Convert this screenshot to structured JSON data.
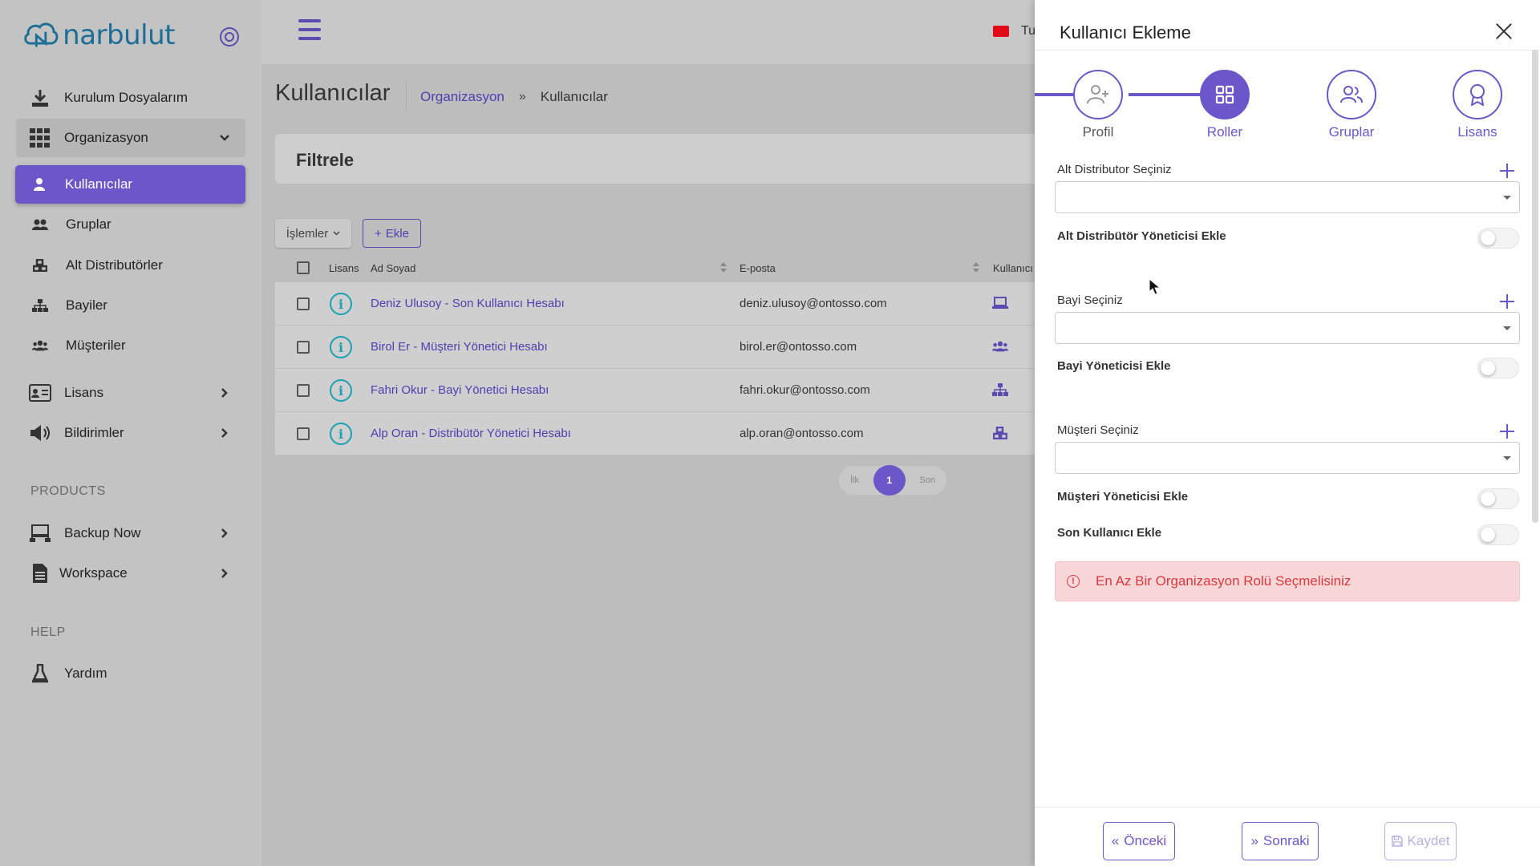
{
  "brand": {
    "name": "narbulut"
  },
  "sidebar": {
    "items": [
      {
        "label": "Kurulum Dosyalarım",
        "icon": "download-icon"
      },
      {
        "label": "Organizasyon",
        "icon": "grid-icon"
      },
      {
        "label": "Kullanıcılar",
        "icon": "user-icon"
      },
      {
        "label": "Gruplar",
        "icon": "users-icon"
      },
      {
        "label": "Alt Distributörler",
        "icon": "cubes-icon"
      },
      {
        "label": "Bayiler",
        "icon": "sitemap-icon"
      },
      {
        "label": "Müşteriler",
        "icon": "users-group-icon"
      },
      {
        "label": "Lisans",
        "icon": "id-card-icon"
      },
      {
        "label": "Bildirimler",
        "icon": "megaphone-icon"
      },
      {
        "label": "Backup Now",
        "icon": "network-icon"
      },
      {
        "label": "Workspace",
        "icon": "file-icon"
      },
      {
        "label": "Yardım",
        "icon": "flask-icon"
      }
    ],
    "sections": {
      "products": "PRODUCTS",
      "help": "HELP"
    }
  },
  "topbar": {
    "lang": "Tu"
  },
  "page": {
    "title": "Kullanıcılar",
    "breadcrumb": {
      "link": "Organizasyon",
      "sep": "»",
      "current": "Kullanıcılar"
    },
    "filter_title": "Filtrele",
    "ops_label": "İşlemler",
    "add_label": "Ekle"
  },
  "table": {
    "headers": {
      "license": "Lisans",
      "name": "Ad Soyad",
      "email": "E-posta",
      "type": "Kullanıcı"
    },
    "rows": [
      {
        "name": "Deniz Ulusoy - Son Kullanıcı Hesabı",
        "email": "deniz.ulusoy@ontosso.com",
        "type_icon": "laptop-icon"
      },
      {
        "name": "Birol Er - Müşteri Yönetici Hesabı",
        "email": "birol.er@ontosso.com",
        "type_icon": "users-group-icon"
      },
      {
        "name": "Fahri Okur - Bayi Yönetici Hesabı",
        "email": "fahri.okur@ontosso.com",
        "type_icon": "sitemap-icon"
      },
      {
        "name": "Alp Oran - Distribütör Yönetici Hesabı",
        "email": "alp.oran@ontosso.com",
        "type_icon": "cubes-icon"
      }
    ]
  },
  "pager": {
    "first": "İlk",
    "current": "1",
    "last": "Son"
  },
  "drawer": {
    "title": "Kullanıcı Ekleme",
    "steps": [
      {
        "label": "Profil",
        "icon": "user-plus-icon",
        "state": "done"
      },
      {
        "label": "Roller",
        "icon": "grid-icon",
        "state": "active"
      },
      {
        "label": "Gruplar",
        "icon": "users-icon",
        "state": "pending"
      },
      {
        "label": "Lisans",
        "icon": "award-icon",
        "state": "pending"
      }
    ],
    "alt_distributor_label": "Alt Distributor Seçiniz",
    "alt_distributor_admin": "Alt Distribütör Yöneticisi Ekle",
    "bayi_label": "Bayi Seçiniz",
    "bayi_admin": "Bayi Yöneticisi Ekle",
    "musteri_label": "Müşteri Seçiniz",
    "musteri_admin": "Müşteri Yöneticisi Ekle",
    "son_kullanici": "Son Kullanıcı Ekle",
    "alert": "En Az Bir Organizasyon Rolü Seçmelisiniz",
    "buttons": {
      "prev": "Önceki",
      "next": "Sonraki",
      "save": "Kaydet"
    }
  },
  "colors": {
    "accent": "#6b57c9",
    "info": "#1aa1b5",
    "danger": "#d9383d",
    "alert_bg": "#f9d7d9"
  }
}
